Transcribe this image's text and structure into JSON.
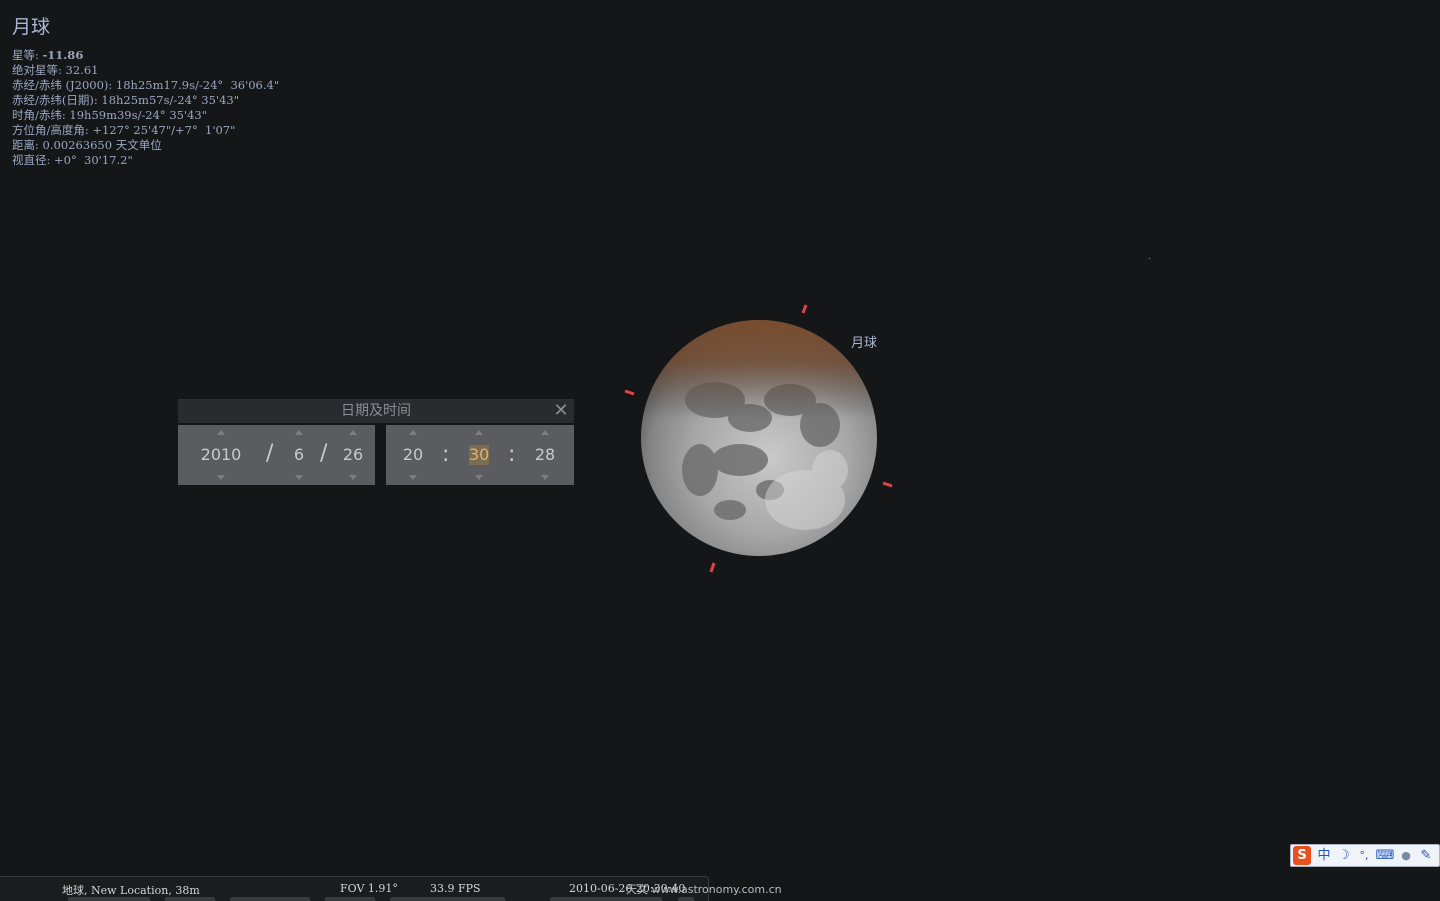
{
  "object_info": {
    "title": "月球",
    "magnitude_label": "星等: ",
    "magnitude_value": "-11.86",
    "abs_magnitude": "绝对星等: 32.61",
    "ra_dec_j2000": "赤经/赤纬 (J2000): 18h25m17.9s/-24°  36'06.4\"",
    "ra_dec_date": "赤经/赤纬(日期): 18h25m57s/-24° 35'43\"",
    "hour_angle_dec": "时角/赤纬: 19h59m39s/-24° 35'43\"",
    "az_alt": "方位角/高度角: +127° 25'47\"/+7°  1'07\"",
    "distance": "距离: 0.00263650 天文单位",
    "apparent_diameter": "视直径: +0°  30'17.2\""
  },
  "moon_label": "月球",
  "datetime_dialog": {
    "title": "日期及时间",
    "year": "2010",
    "month": "6",
    "day": "26",
    "hour": "20",
    "minute": "30",
    "second": "28",
    "date_separator": "/",
    "time_separator": ":"
  },
  "status_bar": {
    "location": "地球, New Location, 38m",
    "fov": "FOV 1.91°",
    "fps": "33.9 FPS",
    "datetime": "2010-06-26  20:30:40"
  },
  "watermark": "天文 www.astronomy.com.cn",
  "ime_toolbar": {
    "logo": "S",
    "lang": "中",
    "moon": "☽",
    "punct": "°,",
    "keyboard": "⌨",
    "user": "●",
    "settings": "✎"
  },
  "colors": {
    "sky": "#151618",
    "info_text": "#9aa7c2",
    "marker": "#e0444a",
    "highlight": "#e0b168"
  }
}
